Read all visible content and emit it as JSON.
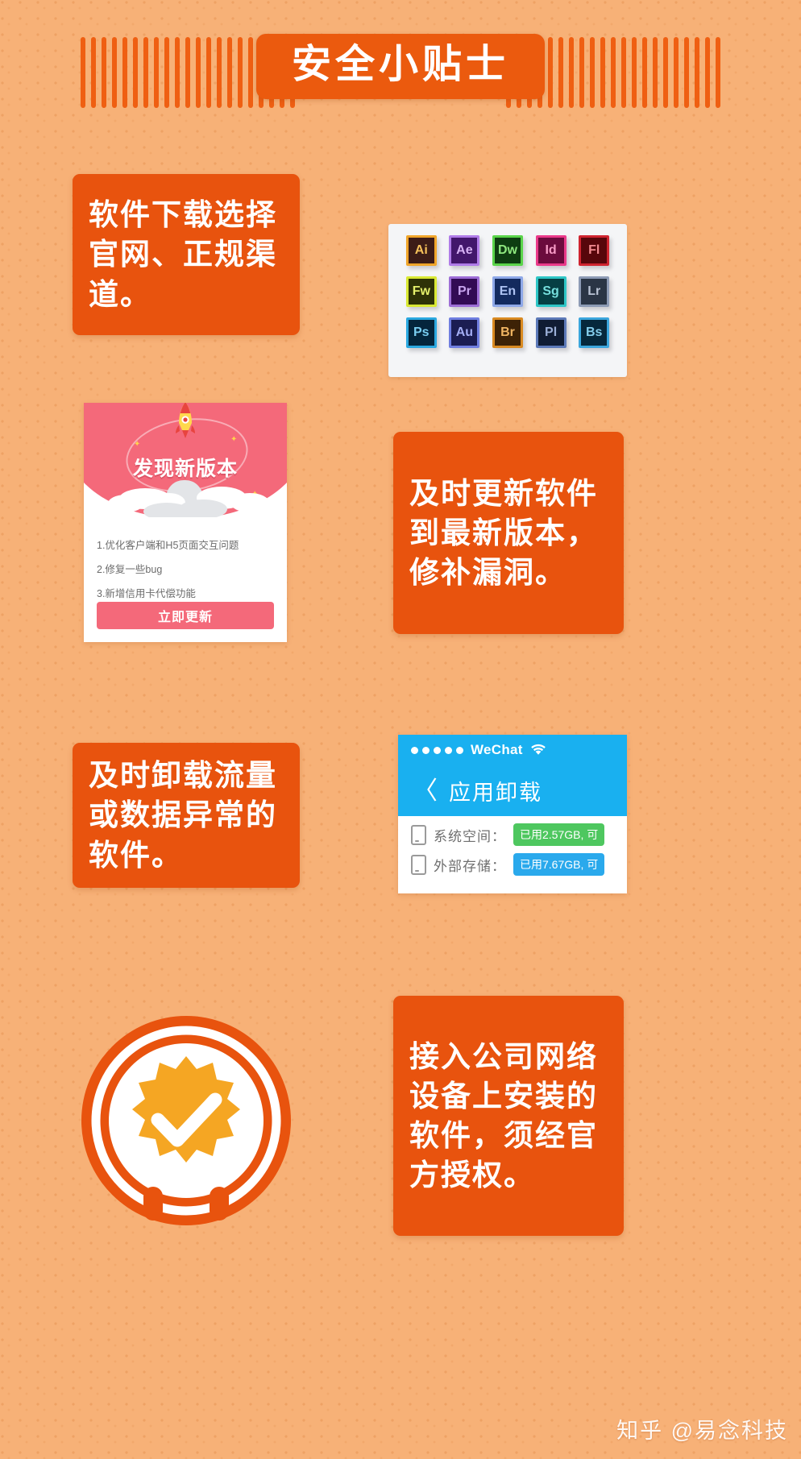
{
  "header": {
    "title": "安全小贴士",
    "stripe_count_left": 21,
    "stripe_count_right": 21,
    "pill_color": "#eb5a0e",
    "stripe_color": "#ef5f12"
  },
  "background": {
    "color": "#f7b177"
  },
  "tips": [
    {
      "id": "tip-download-source",
      "text": "软件下载选择官网、正规渠道。"
    },
    {
      "id": "tip-update-software",
      "text": "及时更新软件到最新版本，修补漏洞。"
    },
    {
      "id": "tip-uninstall-abnormal",
      "text": "及时卸载流量或数据异常的软件。"
    },
    {
      "id": "tip-company-network",
      "text": "接入公司网络设备上安装的软件，须经官方授权。"
    }
  ],
  "adobe_panel": {
    "icons": [
      {
        "label": "Ai",
        "border": "#f0a52a",
        "bg": "#3c1c17",
        "text": "#f6c15a"
      },
      {
        "label": "Ae",
        "border": "#b07ce8",
        "bg": "#42176b",
        "text": "#d7b2f5"
      },
      {
        "label": "Dw",
        "border": "#5ad44a",
        "bg": "#0e3d11",
        "text": "#8fe87f"
      },
      {
        "label": "Id",
        "border": "#ea3a8a",
        "bg": "#6b0b3d",
        "text": "#f79ac6"
      },
      {
        "label": "Fl",
        "border": "#cf2430",
        "bg": "#57060b",
        "text": "#f08a8f"
      },
      {
        "label": "Fw",
        "border": "#d9e833",
        "bg": "#2e3207",
        "text": "#e4ef6b"
      },
      {
        "label": "Pr",
        "border": "#9d6ed6",
        "bg": "#320b54",
        "text": "#c8a4ef"
      },
      {
        "label": "En",
        "border": "#8ea8e8",
        "bg": "#132a5e",
        "text": "#adc2f2"
      },
      {
        "label": "Sg",
        "border": "#2ec6c6",
        "bg": "#063f44",
        "text": "#76e0de"
      },
      {
        "label": "Lr",
        "border": "#8d9bb5",
        "bg": "#2a3545",
        "text": "#b9c3d4"
      },
      {
        "label": "Ps",
        "border": "#2aa8e0",
        "bg": "#04253c",
        "text": "#79cdf0"
      },
      {
        "label": "Au",
        "border": "#6f7ee0",
        "bg": "#1b1d52",
        "text": "#a3adf3"
      },
      {
        "label": "Br",
        "border": "#d98a22",
        "bg": "#3d2206",
        "text": "#f0b462"
      },
      {
        "label": "Pl",
        "border": "#5c79b8",
        "bg": "#101c33",
        "text": "#9aaed6"
      },
      {
        "label": "Bs",
        "border": "#3ba6dd",
        "bg": "#06283c",
        "text": "#84cdec"
      }
    ]
  },
  "update_dialog": {
    "hero_title": "发现新版本",
    "items": [
      "1.优化客户端和H5页面交互问题",
      "2.修复一些bug",
      "3.新增信用卡代偿功能"
    ],
    "button_label": "立即更新",
    "accent_color": "#f4697a"
  },
  "uninstall_panel": {
    "carrier": "WeChat",
    "signal_dots": 5,
    "nav_title": "应用卸载",
    "bar_color": "#19b0f0",
    "rows": [
      {
        "label": "系统空间：",
        "badge": "已用2.57GB, 可",
        "badge_color": "#4ec75f",
        "icon": "phone-icon"
      },
      {
        "label": "外部存储：",
        "badge": "已用7.67GB, 可",
        "badge_color": "#2aa9ec",
        "icon": "sdcard-icon"
      }
    ]
  },
  "emblem": {
    "name": "verified-badge",
    "ring_color": "#ffffff",
    "star_color": "#f5a623",
    "check_color": "#ffffff",
    "disc_color": "#e8530e"
  },
  "watermark": {
    "text": "知乎 @易念科技"
  }
}
